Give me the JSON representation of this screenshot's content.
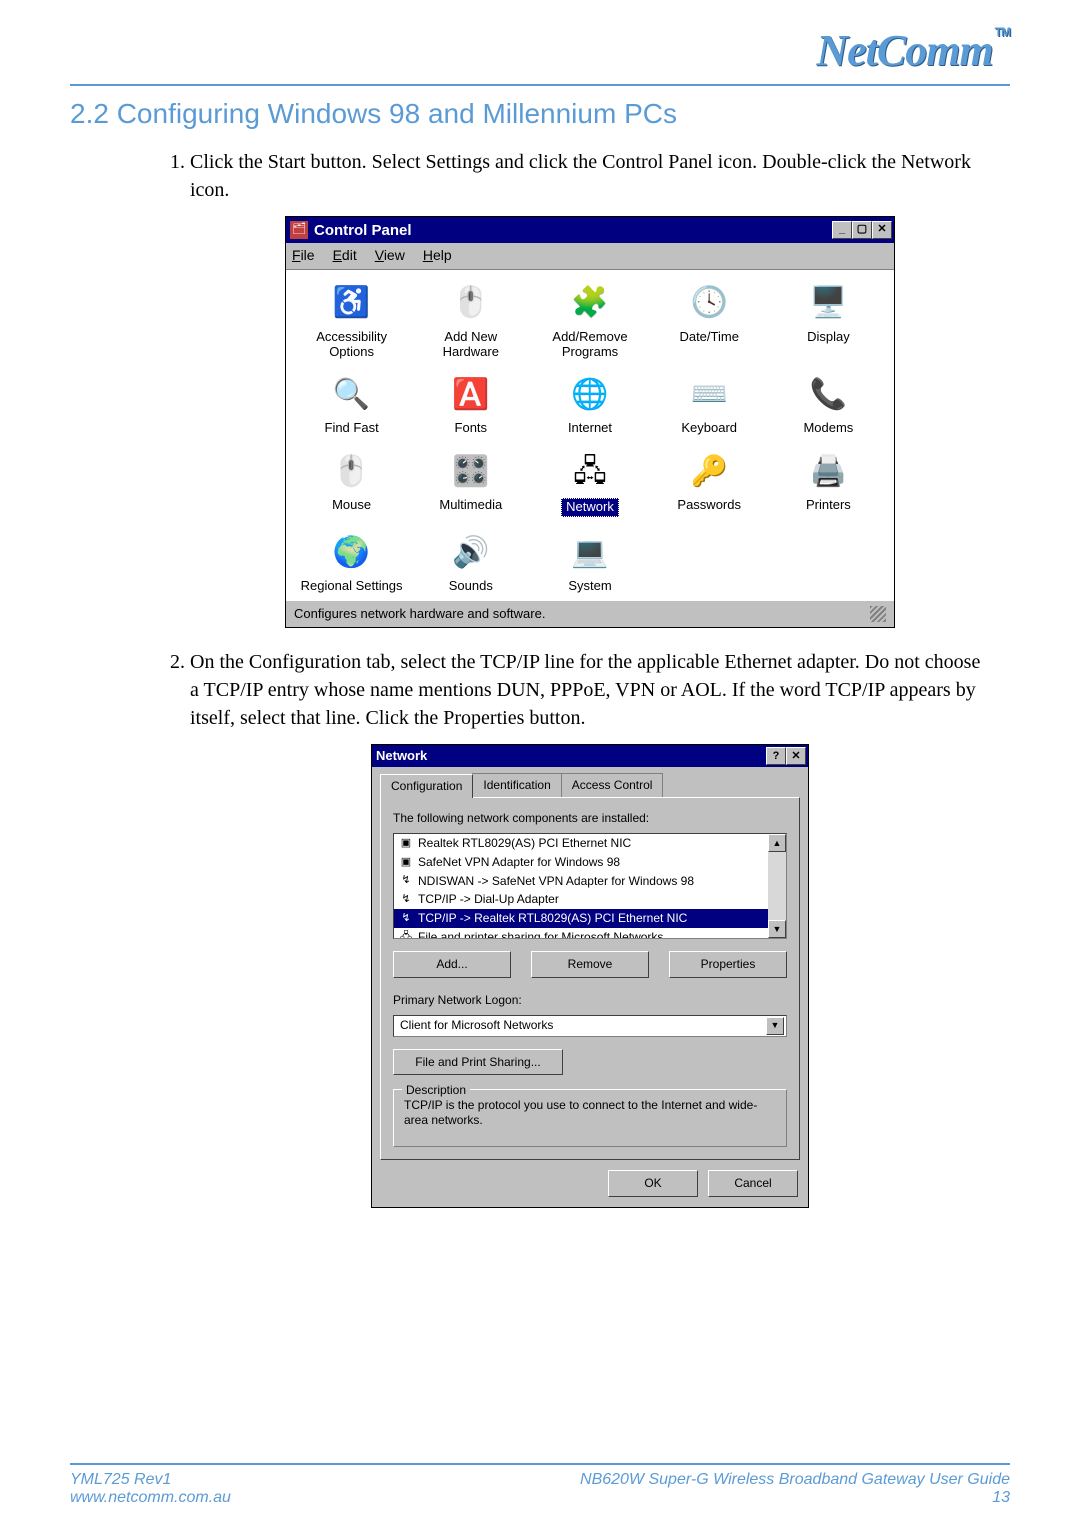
{
  "header": {
    "logo": "NetComm",
    "tm": "TM"
  },
  "section": {
    "number_title": "2.2 Configuring Windows 98 and Millennium PCs"
  },
  "steps": {
    "s1": "Click the Start button. Select Settings and click the Control Panel icon. Double-click the Network icon.",
    "s2": "On the Configuration tab, select the TCP/IP line for the applicable Ethernet adapter. Do not choose a TCP/IP entry whose name mentions DUN, PPPoE, VPN or AOL. If the word TCP/IP appears by itself, select that line. Click the Properties button."
  },
  "control_panel": {
    "title_icon_text": "🗂",
    "title": "Control Panel",
    "menu": {
      "file": "File",
      "edit": "Edit",
      "view": "View",
      "help": "Help"
    },
    "icons": {
      "accessibility": "♿",
      "addnew": "🖱️",
      "addremove": "🧩",
      "datetime": "🕓",
      "display": "🖥️",
      "findfast": "🔍",
      "fonts": "🅰️",
      "internet": "🌐",
      "keyboard": "⌨️",
      "modems": "📞",
      "mouse": "🖱️",
      "multimedia": "🎛️",
      "network": "🖧",
      "passwords": "🔑",
      "printers": "🖨️",
      "regional": "🌍",
      "sounds": "🔊",
      "system": "💻"
    },
    "labels": {
      "accessibility": "Accessibility Options",
      "addnew": "Add New Hardware",
      "addremove": "Add/Remove Programs",
      "datetime": "Date/Time",
      "display": "Display",
      "findfast": "Find Fast",
      "fonts": "Fonts",
      "internet": "Internet",
      "keyboard": "Keyboard",
      "modems": "Modems",
      "mouse": "Mouse",
      "multimedia": "Multimedia",
      "network": "Network",
      "passwords": "Passwords",
      "printers": "Printers",
      "regional": "Regional Settings",
      "sounds": "Sounds",
      "system": "System"
    },
    "status": "Configures network hardware and software.",
    "winbtn": {
      "min": "_",
      "max": "▢",
      "close": "✕"
    }
  },
  "network_dialog": {
    "title": "Network",
    "help_btn": "?",
    "close_btn": "✕",
    "tabs": {
      "config": "Configuration",
      "ident": "Identification",
      "access": "Access Control"
    },
    "installed_label": "The following network components are installed:",
    "components": [
      {
        "icon": "▣",
        "text": "Realtek RTL8029(AS) PCI Ethernet NIC"
      },
      {
        "icon": "▣",
        "text": "SafeNet VPN Adapter for Windows 98"
      },
      {
        "icon": "↯",
        "text": "NDISWAN -> SafeNet VPN Adapter for Windows 98"
      },
      {
        "icon": "↯",
        "text": "TCP/IP -> Dial-Up Adapter"
      },
      {
        "icon": "↯",
        "text": "TCP/IP -> Realtek RTL8029(AS) PCI Ethernet NIC",
        "selected": true
      },
      {
        "icon": "🖧",
        "text": "File and printer sharing for Microsoft Networks"
      }
    ],
    "scroll": {
      "up": "▲",
      "down": "▼"
    },
    "btns": {
      "add": "Add...",
      "remove": "Remove",
      "properties": "Properties"
    },
    "primary_label": "Primary Network Logon:",
    "primary_value": "Client for Microsoft Networks",
    "fps": "File and Print Sharing...",
    "desc_legend": "Description",
    "desc_text": "TCP/IP is the protocol you use to connect to the Internet and wide-area networks.",
    "ok": "OK",
    "cancel": "Cancel"
  },
  "footer": {
    "left1": "YML725 Rev1",
    "left2": "www.netcomm.com.au",
    "right1": "NB620W Super-G Wireless Broadband  Gateway User Guide",
    "right2": "13"
  }
}
